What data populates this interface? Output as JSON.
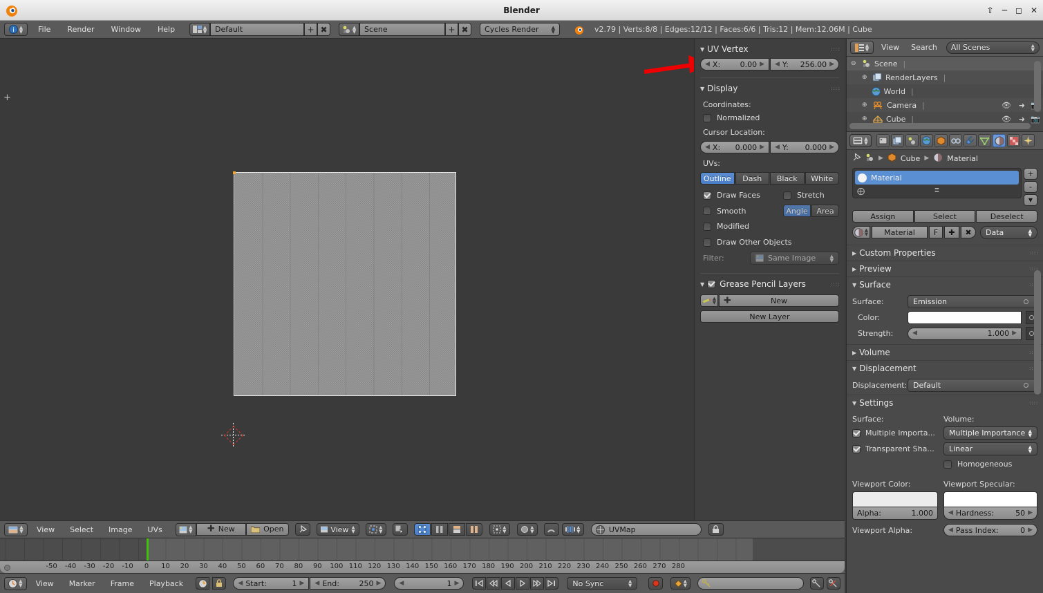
{
  "window": {
    "title": "Blender",
    "minimize": "minimize-icon",
    "maximize": "maximize-icon",
    "close": "close-icon",
    "restore_up": "restore-icon"
  },
  "info_header": {
    "editor_icon": "info-editor-icon",
    "menus": [
      "File",
      "Render",
      "Window",
      "Help"
    ],
    "screen_layout": {
      "icon": "screen-layout-icon",
      "value": "Default",
      "add": "+",
      "remove": "x"
    },
    "scene": {
      "icon": "scene-icon",
      "value": "Scene",
      "add": "+",
      "remove": "x"
    },
    "render_engine": "Cycles Render",
    "status": "v2.79 | Verts:8/8 | Edges:12/12 | Faces:6/6 | Tris:12 | Mem:12.06M | Cube"
  },
  "uv_panel": {
    "uv_vertex": {
      "title": "UV Vertex",
      "x_label": "X:",
      "x_value": "0.00",
      "y_label": "Y:",
      "y_value": "256.00"
    },
    "display": {
      "title": "Display",
      "coordinates_label": "Coordinates:",
      "normalized_label": "Normalized",
      "normalized_checked": false,
      "cursor_location_label": "Cursor Location:",
      "cursor_x_label": "X:",
      "cursor_x_value": "0.000",
      "cursor_y_label": "Y:",
      "cursor_y_value": "0.000",
      "uvs_label": "UVs:",
      "uv_modes": [
        "Outline",
        "Dash",
        "Black",
        "White"
      ],
      "uv_mode_active": "Outline",
      "draw_faces_label": "Draw Faces",
      "draw_faces_checked": true,
      "stretch_label": "Stretch",
      "stretch_checked": false,
      "smooth_label": "Smooth",
      "smooth_checked": false,
      "stretch_modes": [
        "Angle",
        "Area"
      ],
      "stretch_mode_active": "Angle",
      "modified_label": "Modified",
      "modified_checked": false,
      "draw_other_objects_label": "Draw Other Objects",
      "draw_other_objects_checked": false,
      "filter_label": "Filter:",
      "filter_value": "Same Image",
      "filter_icon": "image-icon"
    },
    "grease_pencil": {
      "title": "Grease Pencil Layers",
      "enabled": true,
      "brush_icon": "pencil-icon",
      "new_label": "New",
      "new_layer_label": "New Layer"
    }
  },
  "uv_editor": {
    "editor_icon": "uv-image-editor-icon",
    "menus": [
      "View",
      "Select",
      "Image",
      "UVs"
    ],
    "image_icon": "image-datablock-icon",
    "new_label": "New",
    "open_label": "Open",
    "open_icon": "folder-icon",
    "pin_icon": "pin-icon",
    "view_mode_icon": "image-icon",
    "view_mode_label": "View",
    "pivot_icon": "pivot-icon",
    "snap_icon": "snap-magnet-icon",
    "uv_select_modes": [
      "vertex-select-icon",
      "edge-select-icon",
      "face-select-icon",
      "island-select-icon"
    ],
    "uv_select_active": 0,
    "proportional_icon": "proportional-edit-icon",
    "falloff_icon": "smooth-falloff-icon",
    "uvmap_label": "UVMap",
    "uvmap_icon": "uvmap-icon",
    "lock_icon": "lock-icon"
  },
  "timeline": {
    "editor_icon": "timeline-editor-icon",
    "menus": [
      "View",
      "Marker",
      "Frame",
      "Playback"
    ],
    "auto_key_icon": "record-auto-key-icon",
    "lock_icon": "lock-icon",
    "start_label": "Start:",
    "start_value": "1",
    "end_label": "End:",
    "end_value": "250",
    "current_frame": "1",
    "transport": [
      "jump-to-start-icon",
      "prev-keyframe-icon",
      "play-reverse-icon",
      "play-icon",
      "next-keyframe-icon",
      "jump-to-end-icon"
    ],
    "sync_mode": "No Sync",
    "record_icon": "record-icon",
    "keying_set_icon": "keyingset-icon",
    "keying_set_value": "",
    "insert_key_icon": "insert-keyframe-icon",
    "delete_key_icon": "delete-keyframe-icon",
    "ruler_ticks": [
      "-50",
      "-40",
      "-30",
      "-20",
      "-10",
      "0",
      "10",
      "20",
      "30",
      "40",
      "50",
      "60",
      "70",
      "80",
      "90",
      "100",
      "110",
      "120",
      "130",
      "140",
      "150",
      "160",
      "170",
      "180",
      "190",
      "200",
      "210",
      "220",
      "230",
      "240",
      "250",
      "260",
      "270",
      "280"
    ],
    "playhead_frame": "1"
  },
  "outliner": {
    "editor_icon": "outliner-editor-icon",
    "menus": [
      "View",
      "Search"
    ],
    "display_mode": "All Scenes",
    "rows": [
      {
        "label": "Scene",
        "icon": "scene-icon",
        "indent": 0,
        "expander": "minus",
        "selected": true
      },
      {
        "label": "RenderLayers",
        "icon": "renderlayers-icon",
        "indent": 1,
        "expander": "plus",
        "selected": false
      },
      {
        "label": "World",
        "icon": "world-icon",
        "indent": 1,
        "expander": "none",
        "selected": false
      },
      {
        "label": "Camera",
        "icon": "camera-icon",
        "indent": 1,
        "expander": "plus",
        "selected": false
      },
      {
        "label": "Cube",
        "icon": "mesh-icon",
        "indent": 1,
        "expander": "plus",
        "selected": false
      }
    ],
    "restrict_icons": [
      "eye-icon",
      "cursor-arrow-icon",
      "camera-render-icon"
    ]
  },
  "properties": {
    "tabs": [
      "render-tab-icon",
      "renderlayers-tab-icon",
      "scene-tab-icon",
      "world-tab-icon",
      "object-tab-icon",
      "constraints-tab-icon",
      "modifiers-tab-icon",
      "data-tab-icon",
      "material-tab-icon",
      "texture-tab-icon",
      "particles-tab-icon"
    ],
    "active_tab_index": 8,
    "breadcrumb": {
      "pin_icon": "pin-icon",
      "scene_icon": "scene-icon",
      "object": "Cube",
      "object_icon": "object-icon",
      "material": "Material",
      "material_icon": "material-icon"
    },
    "material_slot": {
      "name": "Material",
      "add": "+",
      "remove": "-",
      "menu": "v"
    },
    "assign_label": "Assign",
    "select_label": "Select",
    "deselect_label": "Deselect",
    "material_datablock": {
      "icon": "material-icon",
      "name": "Material",
      "fake_user": "F",
      "new": "+",
      "unlink": "x"
    },
    "data_dropdown": "Data",
    "sections": {
      "custom_properties": {
        "title": "Custom Properties",
        "open": false
      },
      "preview": {
        "title": "Preview",
        "open": false
      },
      "surface": {
        "title": "Surface",
        "open": true,
        "surface_label": "Surface:",
        "surface_value": "Emission",
        "color_label": "Color:",
        "color_value": "#ffffff",
        "strength_label": "Strength:",
        "strength_value": "1.000"
      },
      "volume": {
        "title": "Volume",
        "open": false
      },
      "displacement": {
        "title": "Displacement",
        "open": true,
        "displacement_label": "Displacement:",
        "displacement_value": "Default"
      },
      "settings": {
        "title": "Settings",
        "open": true,
        "surface_label": "Surface:",
        "volume_label": "Volume:",
        "multiple_importance_label": "Multiple Importa...",
        "multiple_importance_checked": true,
        "transparent_shadows_label": "Transparent Sha...",
        "transparent_shadows_checked": true,
        "volume_sampling_value": "Multiple Importance",
        "volume_interpolation_value": "Linear",
        "homogeneous_label": "Homogeneous",
        "homogeneous_checked": false,
        "viewport_color_label": "Viewport Color:",
        "viewport_color_value": "#ececec",
        "alpha_label": "Alpha:",
        "alpha_value": "1.000",
        "viewport_specular_label": "Viewport Specular:",
        "viewport_specular_value": "#ffffff",
        "hardness_label": "Hardness:",
        "hardness_value": "50",
        "viewport_alpha_label": "Viewport Alpha:",
        "pass_index_label": "Pass Index:",
        "pass_index_value": "0"
      }
    }
  },
  "annotation": {
    "arrow_color": "#ee0000",
    "target": "uv-vertex-y-field"
  }
}
